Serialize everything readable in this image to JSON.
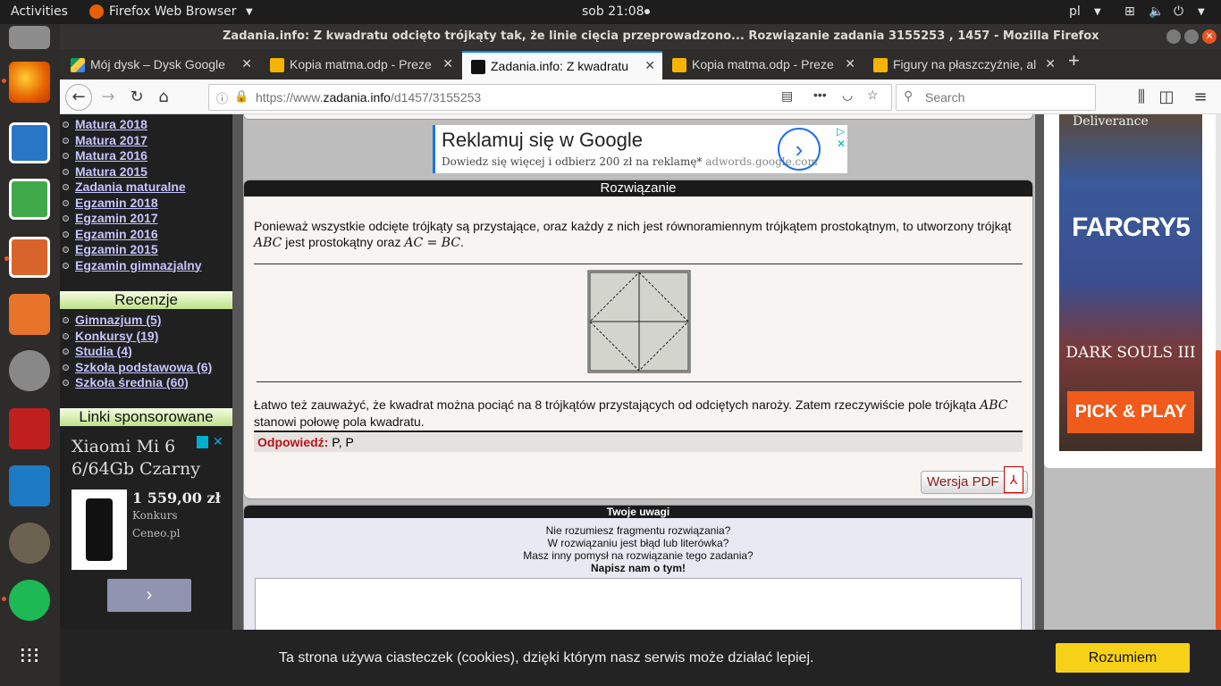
{
  "topbar": {
    "activities": "Activities",
    "app": "Firefox Web Browser",
    "clock": "sob 21:08",
    "lang": "pl"
  },
  "window": {
    "title": "Zadania.info: Z kwadratu odcięto trójkąty tak, że linie cięcia przeprowadzono... Rozwiązanie zadania 3155253 , 1457 - Mozilla Firefox"
  },
  "tabs": [
    {
      "label": "Mój dysk – Dysk Google",
      "icon": "google-drive-icon"
    },
    {
      "label": "Kopia matma.odp - Preze",
      "icon": "slides-icon"
    },
    {
      "label": "Zadania.info: Z kwadratu",
      "icon": "zadania-icon"
    },
    {
      "label": "Kopia matma.odp - Preze",
      "icon": "slides-icon"
    },
    {
      "label": "Figury na płaszczyźnie, al",
      "icon": "slides-icon"
    }
  ],
  "nav": {
    "url_prefix": "https://www.",
    "url_host": "zadania.info",
    "url_path": "/d1457/3155253",
    "search_placeholder": "Search"
  },
  "sidebar": {
    "links1": [
      "Matura 2018",
      "Matura 2017",
      "Matura 2016",
      "Matura 2015",
      "Zadania maturalne",
      "Egzamin 2018",
      "Egzamin 2017",
      "Egzamin 2016",
      "Egzamin 2015",
      "Egzamin gimnazjalny"
    ],
    "recenzje_head": "Recenzje",
    "links2": [
      "Gimnazjum (5)",
      "Konkursy (19)",
      "Studia (4)",
      "Szkoła podstawowa (6)",
      "Szkoła średnia (60)"
    ],
    "sponsored_head": "Linki sponsorowane",
    "ad": {
      "title": "Xiaomi Mi 6 6/64Gb Czarny",
      "price": "1 559,00 zł",
      "shop": "Konkurs",
      "site": "Ceneo.pl"
    }
  },
  "google_ad": {
    "title": "Reklamuj się w Google",
    "text": "Dowiedz się więcej i odbierz 200 zł na reklamę*",
    "url": "adwords.google.com"
  },
  "solution": {
    "heading": "Rozwiązanie",
    "p1a": "Ponieważ wszystkie odcięte trójkąty są przystające, oraz każdy z nich jest równoramiennym trójkątem prostokątnym, to utworzony trójkąt",
    "m1": "ABC",
    "p1b": "jest prostokątny oraz",
    "m2": "AC = BC",
    "p1c": ".",
    "p2a": "Łatwo też zauważyć, że kwadrat można pociąć na 8 trójkątów przystających od odciętych naroży. Zatem rzeczywiście pole trójkąta",
    "m3": "ABC",
    "p2b": "stanowi połowę pola kwadratu.",
    "answer_label": "Odpowiedź:",
    "answer": "P, P",
    "pdf": "Wersja PDF"
  },
  "feedback": {
    "heading": "Twoje uwagi",
    "l1": "Nie rozumiesz fragmentu rozwiązania?",
    "l2": "W rozwiązaniu jest błąd lub literówka?",
    "l3": "Masz inny pomysł na rozwiązanie tego zadania?",
    "l4": "Napisz nam o tym!"
  },
  "right_ad": {
    "top": "Deliverance",
    "game1": "FARCRY5",
    "game2": "DARK SOULS III",
    "cta": "PICK & PLAY"
  },
  "cookie": {
    "text": "Ta strona używa ciasteczek (cookies), dzięki którym nasz serwis może działać lepiej.",
    "button": "Rozumiem"
  }
}
